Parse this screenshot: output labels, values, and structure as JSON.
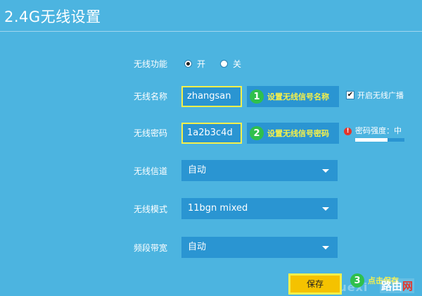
{
  "page": {
    "title": "2.4G无线设置"
  },
  "wireless_function": {
    "label": "无线功能",
    "options": [
      {
        "label": "开",
        "checked": true
      },
      {
        "label": "关",
        "checked": false
      }
    ]
  },
  "ssid": {
    "label": "无线名称",
    "value": "zhangsan",
    "step_number": "1",
    "hint": "设置无线信号名称",
    "broadcast_label": "开启无线广播",
    "broadcast_checked": true
  },
  "password": {
    "label": "无线密码",
    "value": "1a2b3c4d",
    "step_number": "2",
    "hint": "设置无线信号密码",
    "strength_text": "密码强度：中",
    "strength_level": 0.65
  },
  "channel": {
    "label": "无线信道",
    "value": "自动"
  },
  "mode": {
    "label": "无线模式",
    "value": "11bgn mixed"
  },
  "bandwidth": {
    "label": "频段带宽",
    "value": "自动"
  },
  "save": {
    "label": "保存",
    "step_number": "3",
    "hint": "点击保存"
  },
  "watermark": {
    "text": "xuexi",
    "logo_a": "路由",
    "logo_b": "网"
  },
  "colors": {
    "background": "#4cb4e0",
    "field": "#2a95d2",
    "highlight": "#f5f04a",
    "step_green": "#2fc04c",
    "button": "#f5c200",
    "warning": "#e5342a"
  }
}
